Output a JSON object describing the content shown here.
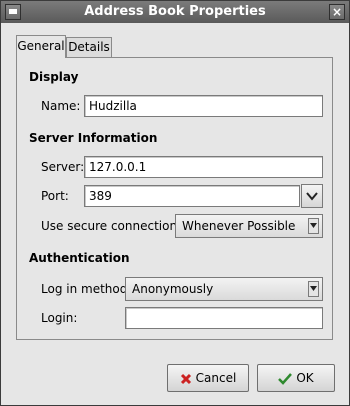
{
  "window": {
    "title": "Address Book Properties",
    "menu_icon": "window-menu-icon",
    "close_icon": "close-icon",
    "close_glyph": "×"
  },
  "tabs": [
    {
      "label": "General",
      "active": true
    },
    {
      "label": "Details",
      "active": false
    }
  ],
  "display": {
    "heading": "Display",
    "name_label": "Name:",
    "name_value": "Hudzilla"
  },
  "server": {
    "heading": "Server Information",
    "server_label": "Server:",
    "server_value": "127.0.0.1",
    "port_label": "Port:",
    "port_value": "389",
    "secure_label": "Use secure connection:",
    "secure_value": "Whenever Possible"
  },
  "auth": {
    "heading": "Authentication",
    "method_label": "Log in method:",
    "method_value": "Anonymously",
    "login_label": "Login:",
    "login_value": ""
  },
  "buttons": {
    "cancel_label": "Cancel",
    "ok_label": "OK",
    "cancel_icon": "cancel-x-icon",
    "ok_icon": "checkmark-icon"
  },
  "colors": {
    "titlebar": "#6a6a6a",
    "window_bg": "#e6e6e6",
    "cancel_icon_red": "#cc2222",
    "ok_icon_green": "#2f8a2f"
  }
}
